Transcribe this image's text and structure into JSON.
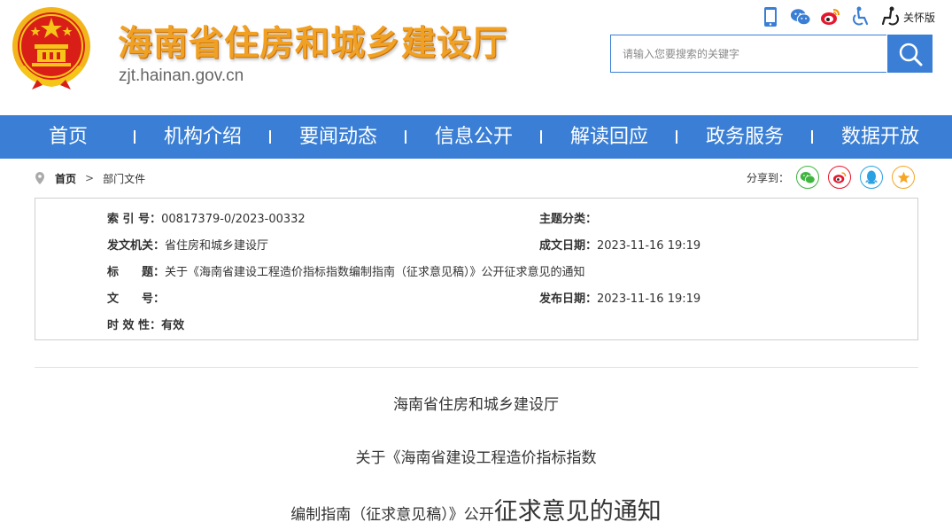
{
  "header": {
    "site_title": "海南省住房和城乡建设厅",
    "site_url": "zjt.hainan.gov.cn",
    "care_label": "关怀版",
    "search_placeholder": "请输入您要搜索的关键字",
    "icons": [
      "mobile-icon",
      "wechat-icon",
      "weibo-icon",
      "accessibility-icon",
      "elder-care-icon"
    ]
  },
  "nav": {
    "items": [
      "首页",
      "机构介绍",
      "要闻动态",
      "信息公开",
      "解读回应",
      "政务服务",
      "数据开放"
    ]
  },
  "breadcrumb": {
    "home": "首页",
    "separator": ">",
    "current": "部门文件"
  },
  "share": {
    "label": "分享到：",
    "targets": [
      "wechat",
      "weibo",
      "qq",
      "qzone"
    ]
  },
  "info": {
    "index_label": "索 引 号：",
    "index_value": "00817379-0/2023-00332",
    "topic_label": "主题分类：",
    "topic_value": "",
    "issuer_label": "发文机关：",
    "issuer_value": "省住房和城乡建设厅",
    "created_label": "成文日期：",
    "created_value": "2023-11-16 19:19",
    "title_label": "标　　题：",
    "title_value": "关于《海南省建设工程造价指标指数编制指南（征求意见稿）》公开征求意见的通知",
    "docno_label": "文　　号：",
    "docno_value": "",
    "published_label": "发布日期：",
    "published_value": "2023-11-16 19:19",
    "validity_label": "时 效 性：",
    "validity_value": "有效"
  },
  "article": {
    "line1": "海南省住房和城乡建设厅",
    "line2": "关于《海南省建设工程造价指标指数",
    "line3_small": "编制指南（征求意见稿）》公开",
    "line3_large": "征求意见的通知"
  },
  "colors": {
    "brand_blue": "#3a7fd5",
    "title_orange": "#f0a023",
    "emblem_red": "#d91e18",
    "emblem_gold": "#f5c518"
  }
}
